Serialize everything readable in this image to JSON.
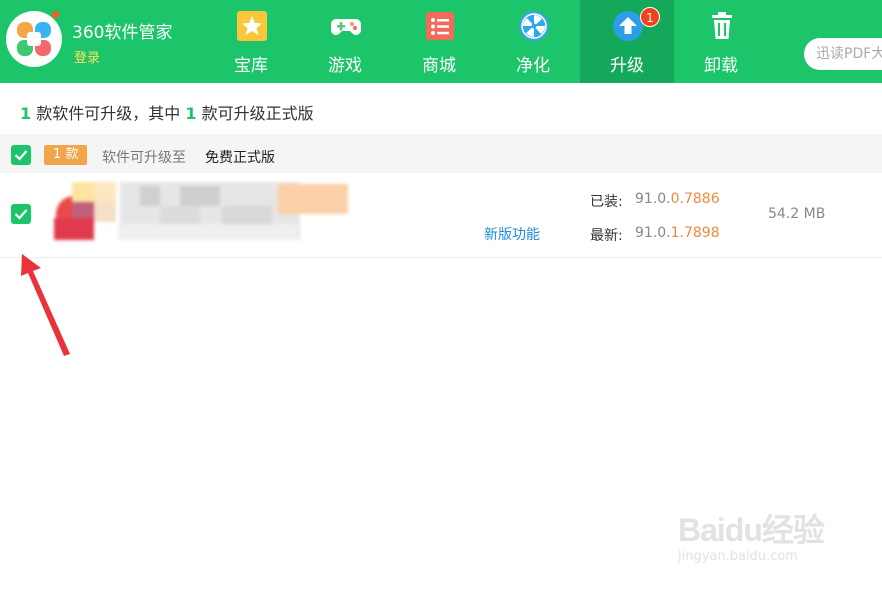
{
  "header": {
    "app_title": "360软件管家",
    "login_label": "登录",
    "tabs": [
      {
        "label": "宝库",
        "icon": "treasure-star-icon"
      },
      {
        "label": "游戏",
        "icon": "gamepad-icon"
      },
      {
        "label": "商城",
        "icon": "store-list-icon"
      },
      {
        "label": "净化",
        "icon": "purify-fan-icon"
      },
      {
        "label": "升级",
        "icon": "upgrade-arrow-icon",
        "badge": "1",
        "active": true
      },
      {
        "label": "卸载",
        "icon": "trash-icon"
      }
    ],
    "search_placeholder": "迅读PDF大"
  },
  "summary": {
    "count_a": "1",
    "text_a": "款软件可升级，其中",
    "count_b": "1",
    "text_b": "款可升级正式版"
  },
  "group": {
    "count_tag": "1 款",
    "desc": "软件可升级至",
    "target": "免费正式版",
    "checked": true
  },
  "item": {
    "checked": true,
    "new_features_label": "新版功能",
    "installed_label": "已装:",
    "installed_prefix": "91.0.",
    "installed_hl": "0.7886",
    "latest_label": "最新:",
    "latest_prefix": "91.0.",
    "latest_hl": "1.7898",
    "size": "54.2 MB"
  },
  "watermark": {
    "main": "Baidu经验",
    "sub": "jingyan.baidu.com"
  },
  "colors": {
    "header_green": "#1cc46a",
    "active_tab": "#13a85a",
    "accent_orange": "#ef8a3c",
    "link_blue": "#1e8ddb",
    "annotation_red": "#e8333a"
  }
}
